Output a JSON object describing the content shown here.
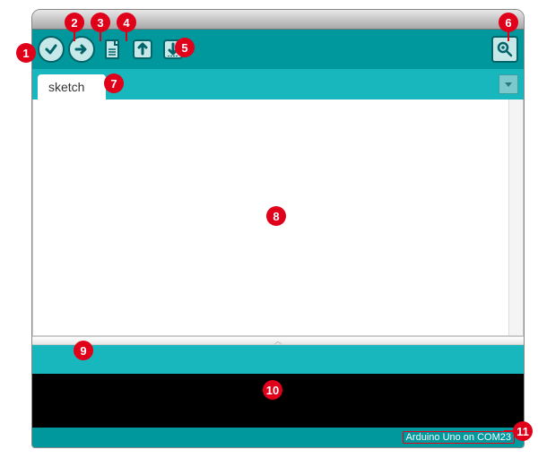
{
  "toolbar": {
    "verify_name": "verify-icon",
    "upload_name": "upload-icon",
    "new_name": "new-file-icon",
    "open_name": "open-file-icon",
    "save_name": "save-file-icon",
    "serial_name": "serial-monitor-icon"
  },
  "tabs": {
    "items": [
      {
        "label": "sketch"
      }
    ],
    "menu_name": "tab-menu-icon"
  },
  "footer": {
    "board_port": "Arduino Uno on COM23"
  },
  "callouts": {
    "c1": "1",
    "c2": "2",
    "c3": "3",
    "c4": "4",
    "c5": "5",
    "c6": "6",
    "c7": "7",
    "c8": "8",
    "c9": "9",
    "c10": "10",
    "c11": "11"
  },
  "colors": {
    "brand": "#00979d",
    "brand_light": "#18b6bd",
    "callout": "#e1001a"
  }
}
